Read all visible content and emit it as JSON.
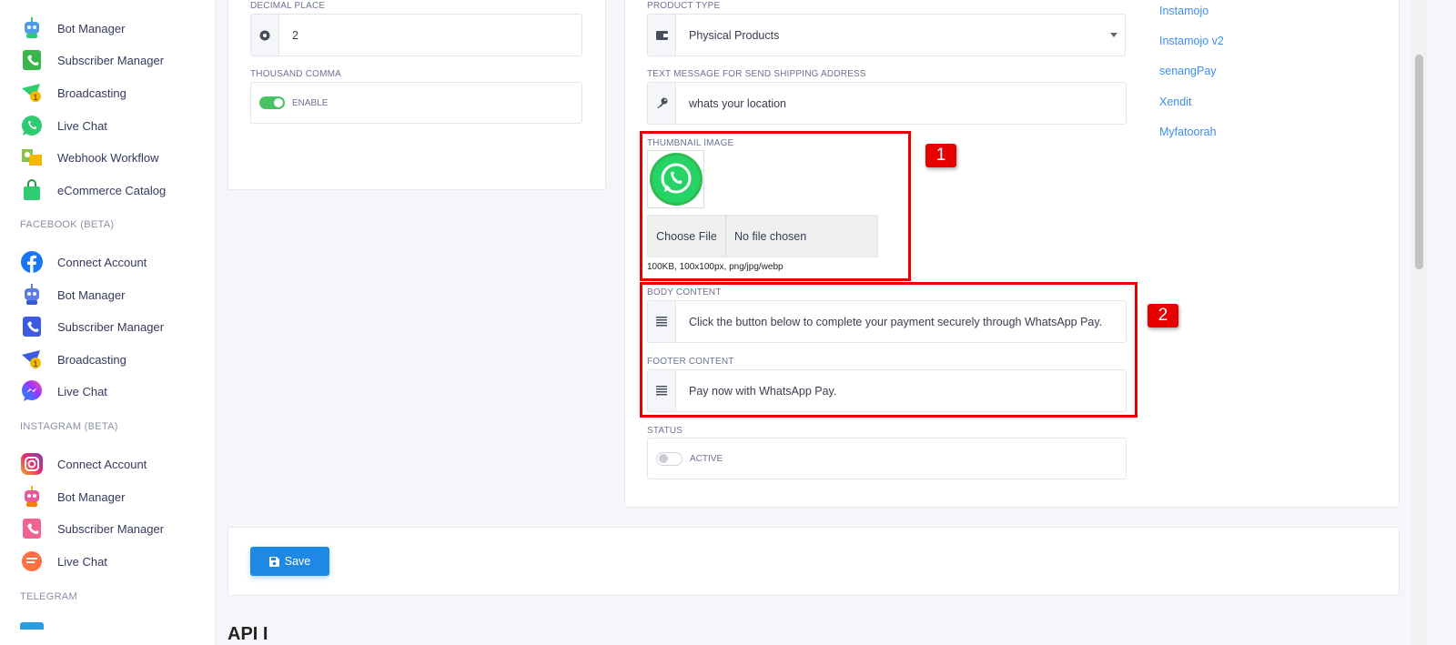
{
  "sidebar": {
    "items_top": [
      {
        "label": "Bot Manager",
        "icon": "bot-icon"
      },
      {
        "label": "Subscriber Manager",
        "icon": "subscriber-icon"
      },
      {
        "label": "Broadcasting",
        "icon": "broadcast-icon"
      },
      {
        "label": "Live Chat",
        "icon": "whatsapp-icon"
      },
      {
        "label": "Webhook Workflow",
        "icon": "webhook-icon"
      },
      {
        "label": "eCommerce Catalog",
        "icon": "shopping-bag-icon"
      }
    ],
    "facebook_heading": "FACEBOOK (BETA)",
    "facebook_items": [
      {
        "label": "Connect Account",
        "icon": "facebook-icon"
      },
      {
        "label": "Bot Manager",
        "icon": "bot-icon"
      },
      {
        "label": "Subscriber Manager",
        "icon": "subscriber-icon"
      },
      {
        "label": "Broadcasting",
        "icon": "broadcast-icon"
      },
      {
        "label": "Live Chat",
        "icon": "messenger-icon"
      }
    ],
    "instagram_heading": "INSTAGRAM (BETA)",
    "instagram_items": [
      {
        "label": "Connect Account",
        "icon": "instagram-icon"
      },
      {
        "label": "Bot Manager",
        "icon": "bot-icon"
      },
      {
        "label": "Subscriber Manager",
        "icon": "subscriber-icon"
      },
      {
        "label": "Live Chat",
        "icon": "chat-icon"
      }
    ],
    "telegram_heading": "TELEGRAM"
  },
  "left_form": {
    "decimal_place_label": "DECIMAL PLACE",
    "decimal_place_value": "2",
    "thousand_comma_label": "THOUSAND COMMA",
    "thousand_comma_toggle": "ENABLE"
  },
  "middle_form": {
    "product_type_label": "PRODUCT TYPE",
    "product_type_value": "Physical Products",
    "text_message_label": "TEXT MESSAGE FOR SEND SHIPPING ADDRESS",
    "text_message_value": "whats your location",
    "thumbnail_label": "THUMBNAIL IMAGE",
    "choose_file": "Choose File",
    "no_file": "No file chosen",
    "file_hint": "100KB, 100x100px, png/jpg/webp",
    "body_label": "BODY CONTENT",
    "body_value": "Click the button below to complete your payment securely through WhatsApp Pay.",
    "footer_label": "FOOTER CONTENT",
    "footer_value": "Pay now with WhatsApp Pay.",
    "status_label": "STATUS",
    "status_toggle": "ACTIVE"
  },
  "gateways": [
    "Instamojo",
    "Instamojo v2",
    "senangPay",
    "Xendit",
    "Myfatoorah"
  ],
  "annotations": [
    "1",
    "2"
  ],
  "save_button": "Save",
  "bottom_heading": "API I",
  "colors": {
    "accent": "#1e88e5",
    "link": "#3b8ef0",
    "toggle_on": "#47c363",
    "annotation_red": "#e60000",
    "whatsapp_green": "#25d366"
  }
}
